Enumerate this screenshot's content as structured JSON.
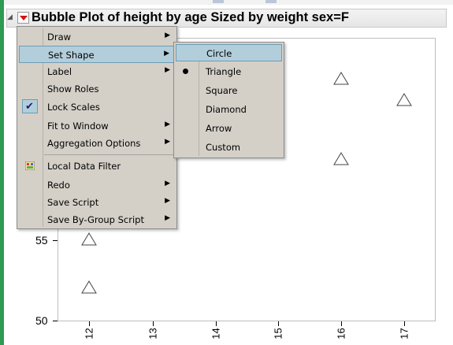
{
  "window": {
    "title": "Bubble Plot of height by age Sized by weight sex=F"
  },
  "plot": {
    "y_ticks": [
      "55",
      "50"
    ],
    "x_ticks": [
      "12",
      "13",
      "14",
      "15",
      "16",
      "17"
    ],
    "marker_shape": "triangle"
  },
  "chart_data": {
    "type": "scatter",
    "x": [
      12,
      12,
      16,
      16,
      17
    ],
    "y": [
      55,
      52,
      60,
      65,
      63.7
    ],
    "x_ticks": [
      "12",
      "13",
      "14",
      "15",
      "16",
      "17"
    ],
    "y_ticks": [
      "50",
      "55"
    ],
    "marker": "triangle"
  },
  "context_menu": {
    "items": [
      {
        "label": "Draw",
        "has_submenu": true
      },
      {
        "label": "Set Shape",
        "has_submenu": true,
        "highlighted": true
      },
      {
        "label": "Label",
        "has_submenu": true
      },
      {
        "label": "Show Roles",
        "has_submenu": false
      },
      {
        "label": "Lock Scales",
        "has_submenu": false,
        "checked": true
      },
      {
        "label": "Fit to Window",
        "has_submenu": true
      },
      {
        "label": "Aggregation Options",
        "has_submenu": true
      },
      {
        "label": "Local Data Filter",
        "has_submenu": false,
        "icon": "filter-icon"
      },
      {
        "label": "Redo",
        "has_submenu": true
      },
      {
        "label": "Save Script",
        "has_submenu": true
      },
      {
        "label": "Save By-Group Script",
        "has_submenu": true
      }
    ]
  },
  "shape_submenu": {
    "items": [
      {
        "label": "Circle",
        "highlighted": true
      },
      {
        "label": "Triangle",
        "selected": true
      },
      {
        "label": "Square"
      },
      {
        "label": "Diamond"
      },
      {
        "label": "Arrow"
      },
      {
        "label": "Custom"
      }
    ]
  },
  "colors": {
    "menu_bg": "#d4d0c8",
    "highlight": "#b3cedb",
    "highlight_border": "#6e9cb3",
    "left_accent": "#2e9a53"
  }
}
